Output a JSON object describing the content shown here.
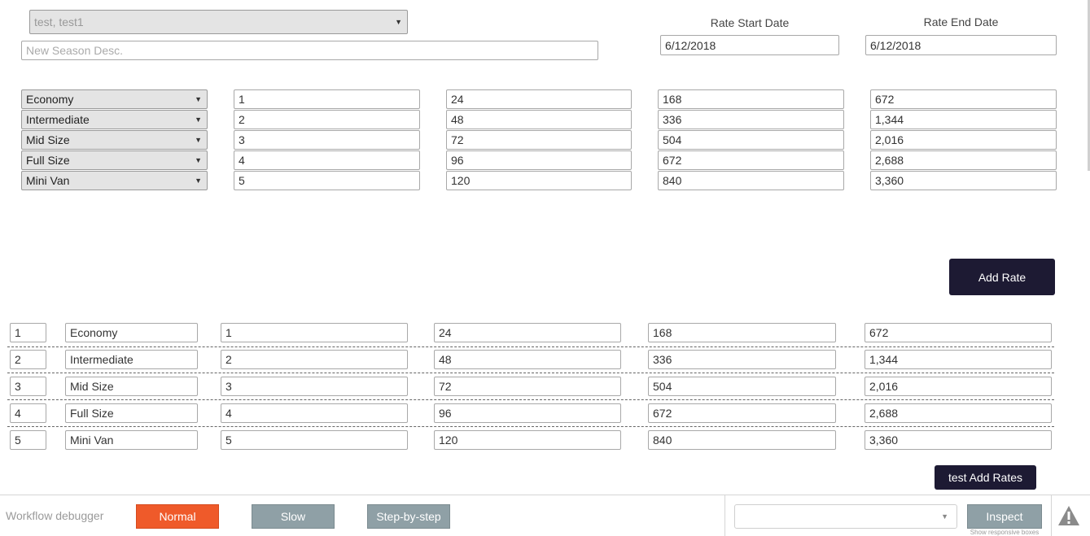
{
  "header": {
    "user_select": "test, test1",
    "season_placeholder": "New Season Desc.",
    "start_label": "Rate Start Date",
    "end_label": "Rate End Date",
    "start_date": "6/12/2018",
    "end_date": "6/12/2018"
  },
  "entry_rows": [
    {
      "class": "Economy",
      "c1": "1",
      "c2": "24",
      "c3": "168",
      "c4": "672"
    },
    {
      "class": "Intermediate",
      "c1": "2",
      "c2": "48",
      "c3": "336",
      "c4": "1,344"
    },
    {
      "class": "Mid Size",
      "c1": "3",
      "c2": "72",
      "c3": "504",
      "c4": "2,016"
    },
    {
      "class": "Full Size",
      "c1": "4",
      "c2": "96",
      "c3": "672",
      "c4": "2,688"
    },
    {
      "class": "Mini Van",
      "c1": "5",
      "c2": "120",
      "c3": "840",
      "c4": "3,360"
    }
  ],
  "add_rate_label": "Add Rate",
  "list_rows": [
    {
      "id": "1",
      "class": "Economy",
      "c1": "1",
      "c2": "24",
      "c3": "168",
      "c4": "672"
    },
    {
      "id": "2",
      "class": "Intermediate",
      "c1": "2",
      "c2": "48",
      "c3": "336",
      "c4": "1,344"
    },
    {
      "id": "3",
      "class": "Mid Size",
      "c1": "3",
      "c2": "72",
      "c3": "504",
      "c4": "2,016"
    },
    {
      "id": "4",
      "class": "Full Size",
      "c1": "4",
      "c2": "96",
      "c3": "672",
      "c4": "2,688"
    },
    {
      "id": "5",
      "class": "Mini Van",
      "c1": "5",
      "c2": "120",
      "c3": "840",
      "c4": "3,360"
    }
  ],
  "test_add_rates_label": "test Add Rates",
  "debugger": {
    "title": "Workflow debugger",
    "normal": "Normal",
    "slow": "Slow",
    "step": "Step-by-step",
    "inspect": "Inspect",
    "inspect_sub": "Show responsive boxes",
    "warning_icon": "warning-icon"
  },
  "colors": {
    "dark_button": "#1d1a33",
    "normal_button": "#ef5a2a",
    "gray_button": "#8fa0a6"
  }
}
